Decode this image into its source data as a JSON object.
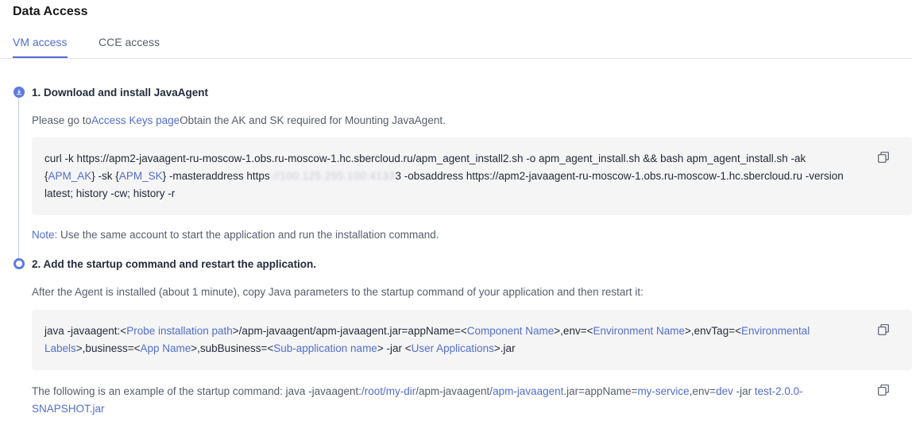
{
  "page_title": "Data Access",
  "tabs": [
    {
      "label": "VM access",
      "active": true
    },
    {
      "label": "CCE access",
      "active": false
    }
  ],
  "step1": {
    "title": "1. Download and install JavaAgent",
    "desc_prefix": "Please go to",
    "desc_link": "Access Keys page",
    "desc_suffix": "Obtain the AK and SK required for Mounting JavaAgent.",
    "code": {
      "line1": "curl -k https://apm2-javaagent-ru-moscow-1.obs.ru-moscow-1.hc.sbercloud.ru/apm_agent_install2.sh -o apm_agent_install.sh && bash apm_agent_install.sh -ak",
      "l2_a": "{",
      "l2_ak": "APM_AK",
      "l2_b": "} -sk {",
      "l2_sk": "APM_SK",
      "l2_c": "} -masteraddress https",
      "l2_masked": "://100.125.255.100:4133",
      "l2_d": "3 -obsaddress https://apm2-javaagent-ru-moscow-1.obs.ru-moscow-1.hc.sbercloud.ru -version",
      "line3": "latest; history -cw; history -r"
    },
    "note_label": "Note:",
    "note_text": " Use the same account to start the application and run the installation command."
  },
  "step2": {
    "title": "2. Add the startup command and restart the application.",
    "desc": "After the Agent is installed (about 1 minute), copy Java parameters to the startup command of your application and then restart it:",
    "code": {
      "a": "java -javaagent:<",
      "probe": "Probe installation path",
      "b": ">/apm-javaagent/apm-javaagent.jar=appName=<",
      "component": "Component Name",
      "c": ">,env=<",
      "environment": "Environment Name",
      "d": ">,envTag=<",
      "envlabels1": "Environmental",
      "envlabels2": "Labels",
      "e": ">,business=<",
      "appname": "App Name",
      "f": ">,subBusiness=<",
      "subapp": "Sub-application name",
      "g": "> -jar <",
      "userapps": "User Applications",
      "h": ">.jar"
    },
    "example": {
      "a": "The following is an example of the startup command: java -javaagent:",
      "root": "/root/my-dir",
      "b": "/apm-javaagent/",
      "jar": "apm-javaagent",
      "c": ".jar=appName=",
      "service": "my-service",
      "d": ",env=",
      "env": "dev",
      "e": " -jar ",
      "testjar1": "test-2.0.0-",
      "testjar2": "SNAPSHOT.jar"
    }
  },
  "icons": {
    "copy": "copy-icon",
    "download": "download-icon"
  },
  "colors": {
    "accent": "#526ecc",
    "code_bg": "#f5f5f6"
  }
}
